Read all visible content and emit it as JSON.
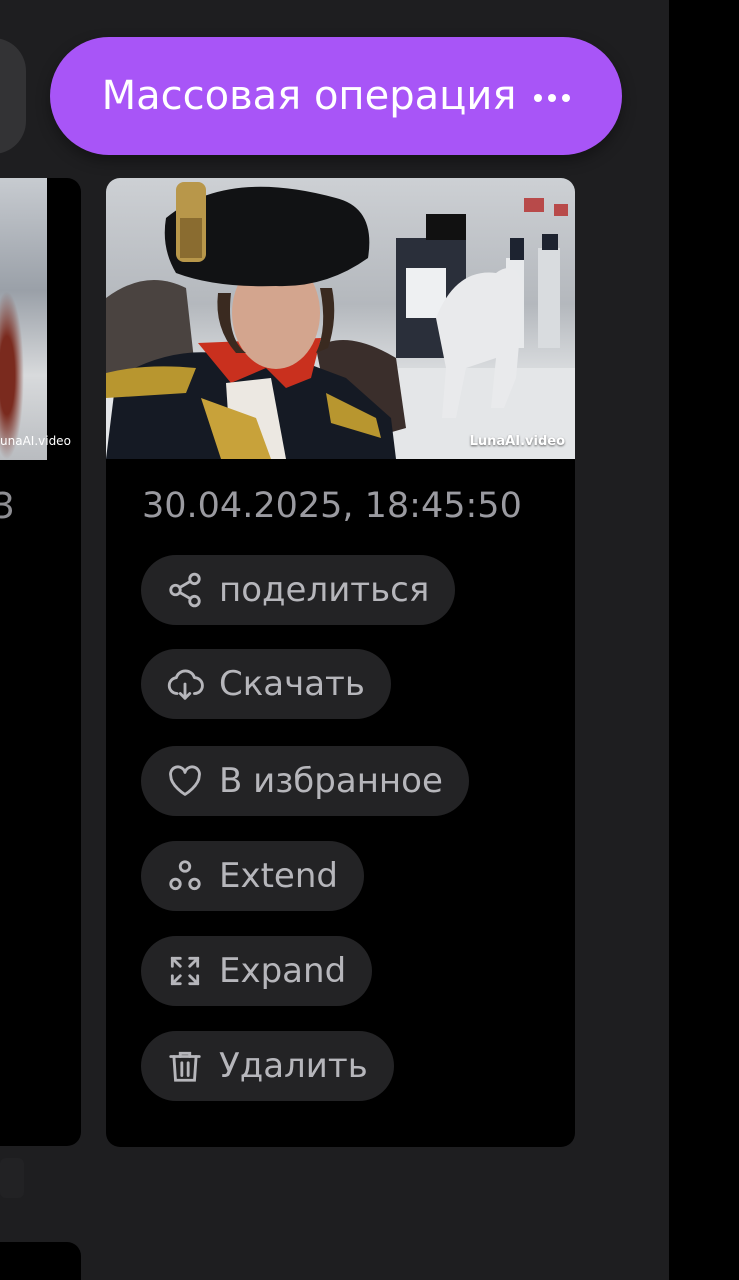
{
  "header": {
    "mass_operation_label": "Массовая операция",
    "more_icon": "ellipsis-icon"
  },
  "left_card": {
    "watermark_fragment": "unaAI.video",
    "date_fragment": "3"
  },
  "card": {
    "watermark": "LunaAI.video",
    "date": "30.04.2025, 18:45:50",
    "actions": [
      {
        "label": "поделиться",
        "icon": "share-icon"
      },
      {
        "label": "Скачать",
        "icon": "cloud-download-icon"
      },
      {
        "label": "В избранное",
        "icon": "heart-icon"
      },
      {
        "label": "Extend",
        "icon": "extend-icon"
      },
      {
        "label": "Expand",
        "icon": "expand-arrows-icon"
      },
      {
        "label": "Удалить",
        "icon": "trash-icon"
      }
    ]
  },
  "colors": {
    "accent": "#a855f7",
    "background": "#1e1e20",
    "card": "#000000",
    "action_bg": "#232325",
    "text_muted": "#9a9aa0"
  }
}
